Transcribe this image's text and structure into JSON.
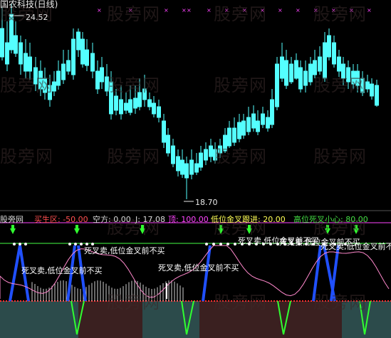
{
  "title": "国农科技(日线)",
  "price_high_label": "24.52",
  "price_low_label": "18.70",
  "watermark": "股旁网",
  "indicator_header": {
    "name": "股旁网",
    "buy_zone": "买生区: -50.00",
    "short": "空方: 0.00",
    "j": "J: 17.08",
    "top": "顶: 100.00",
    "low_cross": "低位金叉跟进: 20.00",
    "high_cross": "高位死叉小心: 80.00"
  },
  "annotations": {
    "a1": "死叉卖,低位金叉前不买",
    "a2": "死叉卖,低位金叉前不买",
    "a3": "死叉卖,低位金叉前不买",
    "a4": "死叉卖,低位金叉前不买",
    "a5": "死叉卖,低位金叉前不买",
    "a6": "死叉卖,低位金叉前不买"
  },
  "colors": {
    "up": "#ff5050",
    "down": "#54ffff",
    "header_red": "#ff5050",
    "header_white": "#d8d8d8",
    "header_magenta": "#ff44ff",
    "header_yellow": "#ffff55",
    "header_green": "#44dd44"
  }
}
